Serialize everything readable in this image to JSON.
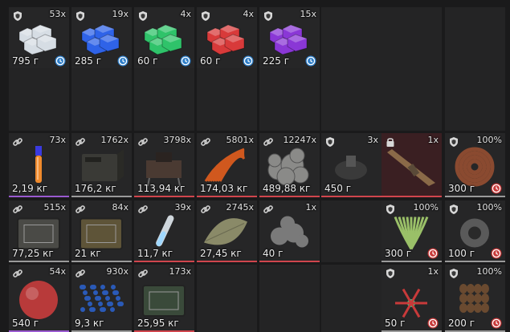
{
  "colors": {
    "background": "#1a1a1b",
    "cell": "#262627",
    "text": "#ececec",
    "quality_gray": "#9a9a9a",
    "quality_blue": "#5a68d8",
    "quality_green": "#3fae63",
    "quality_red": "#d0454d",
    "quality_purple": "#9a5ad0",
    "timer_blue": "#2f7fc9",
    "timer_red": "#c83a3a"
  },
  "rows": [
    {
      "cells": [
        {
          "art": "crystal",
          "tint": "#d6dde4",
          "badge": "shield-icon",
          "count": "53x",
          "weight": "795 г",
          "clock": "blue",
          "bar": "#bdbdbd"
        },
        {
          "art": "crystal",
          "tint": "#2f63e8",
          "badge": "shield-icon",
          "count": "19x",
          "weight": "285 г",
          "clock": "blue",
          "bar": "#5a68d8"
        },
        {
          "art": "crystal",
          "tint": "#2fc36a",
          "badge": "shield-icon",
          "count": "4x",
          "weight": "60 г",
          "clock": "blue",
          "bar": "#3fae63"
        },
        {
          "art": "crystal",
          "tint": "#d83a3a",
          "badge": "shield-icon",
          "count": "4x",
          "weight": "60 г",
          "clock": "blue",
          "bar": "#d0454d"
        },
        {
          "art": "crystal",
          "tint": "#8a37d6",
          "badge": "shield-icon",
          "count": "15x",
          "weight": "225 г",
          "clock": "blue",
          "bar": "#9a5ad0"
        },
        {
          "empty": true
        },
        {
          "empty": true
        },
        {
          "empty": true
        }
      ]
    },
    {
      "cells": [
        {
          "empty": true
        },
        {
          "empty": true
        },
        {
          "empty": true
        },
        {
          "empty": true
        },
        {
          "empty": true
        },
        {
          "empty": true
        },
        {
          "empty": true
        },
        {
          "empty": true
        }
      ]
    },
    {
      "cells": [
        {
          "art": "tube",
          "tint": "#f08a2c",
          "badge": "link-icon",
          "count": "73x",
          "weight": "2,19 кг",
          "bar": "#9a5ad0"
        },
        {
          "art": "box",
          "tint": "#3a3a36",
          "badge": "link-icon",
          "count": "1762x",
          "weight": "176,2 кг",
          "bar": "#9a9a9a"
        },
        {
          "art": "device",
          "tint": "#4a3a32",
          "badge": "link-icon",
          "count": "3798x",
          "weight": "113,94 кг",
          "bar": "#d0454d"
        },
        {
          "art": "fan",
          "tint": "#d0581e",
          "badge": "link-icon",
          "count": "5801x",
          "weight": "174,03 кг",
          "bar": "#d0454d"
        },
        {
          "art": "rubble",
          "tint": "#8a8a88",
          "badge": "link-icon",
          "count": "12247x",
          "weight": "489,88 кг",
          "bar": "#d0454d"
        },
        {
          "art": "mech",
          "tint": "#3a3a3a",
          "badge": "shield-icon",
          "count": "3x",
          "weight": "450 г",
          "bar": "#d0454d"
        },
        {
          "art": "rifle",
          "tint": "#8a6a48",
          "badge": "lock-icon",
          "count": "1x",
          "weight": "",
          "bar": "#d0454d",
          "highlight": true
        },
        {
          "art": "coil",
          "tint": "#8a4a30",
          "badge": "shield-icon",
          "count": "100%",
          "weight": "300 г",
          "clock": "red",
          "bar": "#9a9a9a"
        }
      ]
    },
    {
      "cells": [
        {
          "art": "crate",
          "tint": "#4a4a46",
          "badge": "link-icon",
          "count": "515x",
          "weight": "77,25 кг",
          "bar": "#9a9a9a"
        },
        {
          "art": "crate",
          "tint": "#5e5438",
          "badge": "link-icon",
          "count": "84x",
          "weight": "21 кг",
          "bar": "#9a9a9a"
        },
        {
          "art": "vial",
          "tint": "#9fd8ff",
          "badge": "link-icon",
          "count": "39x",
          "weight": "11,7 кг",
          "bar": "#d0454d"
        },
        {
          "art": "leaf",
          "tint": "#8a8a68",
          "badge": "link-icon",
          "count": "2745x",
          "weight": "27,45 кг",
          "bar": "#d0454d"
        },
        {
          "art": "blobs",
          "tint": "#7a7a7a",
          "badge": "link-icon",
          "count": "1x",
          "weight": "40 г",
          "bar": "#d0454d"
        },
        {
          "empty": true
        },
        {
          "art": "plant",
          "tint": "#9ac068",
          "badge": "shield-icon",
          "count": "100%",
          "weight": "300 г",
          "clock": "red",
          "bar": "#9a9a9a"
        },
        {
          "art": "gear",
          "tint": "#5a5a5a",
          "badge": "shield-icon",
          "count": "100%",
          "weight": "100 г",
          "clock": "red",
          "bar": "#9a9a9a"
        }
      ]
    },
    {
      "cells": [
        {
          "art": "orb",
          "tint": "#b83a3a",
          "badge": "link-icon",
          "count": "54x",
          "weight": "540 г",
          "bar": "#9a5ad0"
        },
        {
          "art": "pebbles",
          "tint": "#2a5ab8",
          "badge": "link-icon",
          "count": "930x",
          "weight": "9,3 кг",
          "bar": "#9a9a9a"
        },
        {
          "art": "crate",
          "tint": "#3a4a3a",
          "badge": "link-icon",
          "count": "173x",
          "weight": "25,95 кг",
          "bar": "#d0454d"
        },
        {
          "empty": true
        },
        {
          "empty": true
        },
        {
          "empty": true
        },
        {
          "art": "flower",
          "tint": "#c83a3a",
          "badge": "shield-icon",
          "count": "1x",
          "weight": "50 г",
          "clock": "red",
          "bar": "#9a9a9a"
        },
        {
          "art": "seeds",
          "tint": "#6a4a30",
          "badge": "shield-icon",
          "count": "100%",
          "weight": "200 г",
          "clock": "red",
          "bar": "#9a9a9a"
        }
      ]
    }
  ]
}
